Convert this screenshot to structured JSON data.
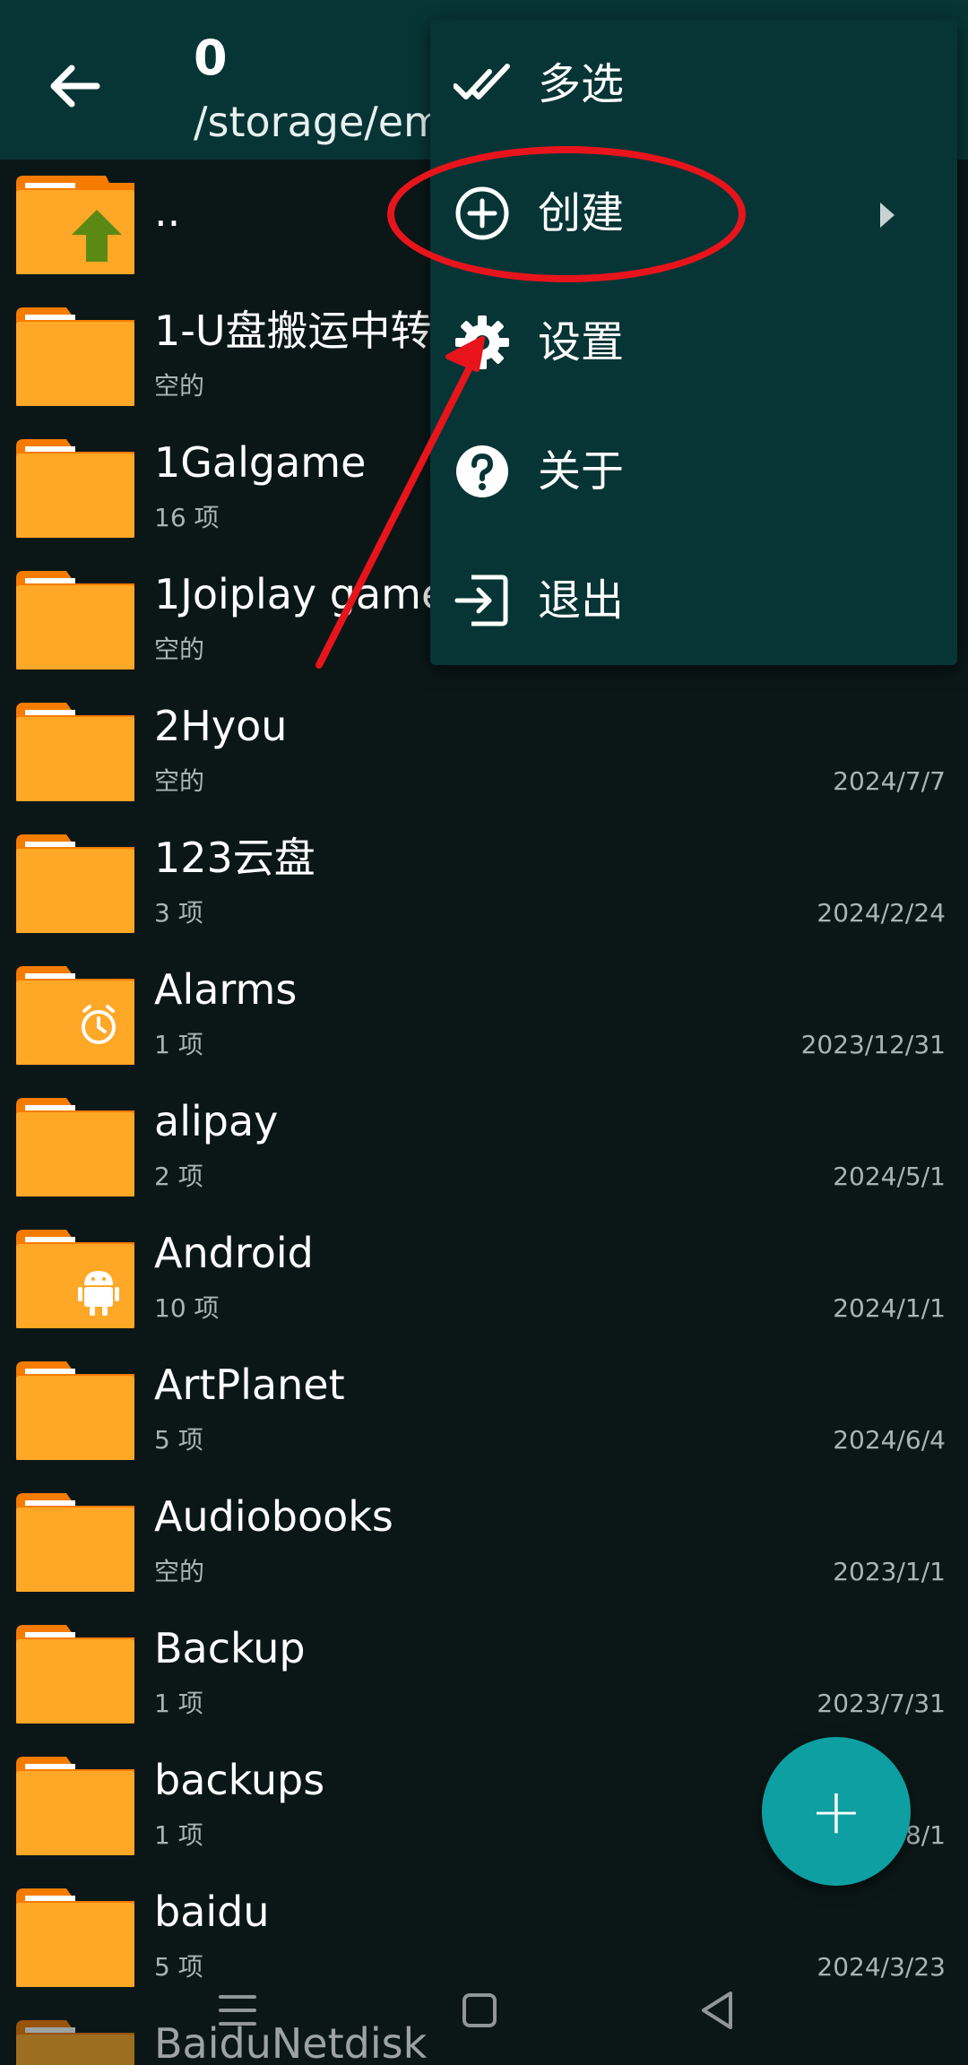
{
  "header": {
    "count": "0",
    "path": "/storage/em"
  },
  "menu": {
    "items": [
      {
        "label": "多选",
        "icon": "multi-select-icon"
      },
      {
        "label": "创建",
        "icon": "add-circle-icon",
        "has_submenu": true
      },
      {
        "label": "设置",
        "icon": "gear-icon"
      },
      {
        "label": "关于",
        "icon": "help-icon"
      },
      {
        "label": "退出",
        "icon": "exit-icon"
      }
    ]
  },
  "files": [
    {
      "name": "..",
      "sub": "",
      "date": "",
      "icon": "parent-folder-icon"
    },
    {
      "name": "1-U盘搬运中转",
      "sub": "空的",
      "date": "",
      "icon": "folder-icon"
    },
    {
      "name": "1Galgame",
      "sub": "16 项",
      "date": "",
      "icon": "folder-icon"
    },
    {
      "name": "1Joiplay game",
      "sub": "空的",
      "date": "",
      "icon": "folder-icon"
    },
    {
      "name": "2Hyou",
      "sub": "空的",
      "date": "2024/7/7",
      "icon": "folder-icon"
    },
    {
      "name": "123云盘",
      "sub": "3 项",
      "date": "2024/2/24",
      "icon": "folder-icon"
    },
    {
      "name": "Alarms",
      "sub": "1 项",
      "date": "2023/12/31",
      "icon": "alarm-folder-icon"
    },
    {
      "name": "alipay",
      "sub": "2 项",
      "date": "2024/5/1",
      "icon": "folder-icon"
    },
    {
      "name": "Android",
      "sub": "10 项",
      "date": "2024/1/1",
      "icon": "android-folder-icon"
    },
    {
      "name": "ArtPlanet",
      "sub": "5 项",
      "date": "2024/6/4",
      "icon": "folder-icon"
    },
    {
      "name": "Audiobooks",
      "sub": "空的",
      "date": "2023/1/1",
      "icon": "folder-icon"
    },
    {
      "name": "Backup",
      "sub": "1 项",
      "date": "2023/7/31",
      "icon": "folder-icon"
    },
    {
      "name": "backups",
      "sub": "1 项",
      "date": "8/1",
      "icon": "folder-icon"
    },
    {
      "name": "baidu",
      "sub": "5 项",
      "date": "2024/3/23",
      "icon": "folder-icon"
    },
    {
      "name": "BaiduNetdisk",
      "sub": "",
      "date": "",
      "icon": "folder-icon"
    }
  ],
  "fab": {
    "label": "+"
  },
  "colors": {
    "background": "#0b1717",
    "toolbar": "#073536",
    "folder": "#ffa726",
    "folder_tab": "#f57c00",
    "accent": "#0d9fa2",
    "annotation": "#e8141c"
  }
}
